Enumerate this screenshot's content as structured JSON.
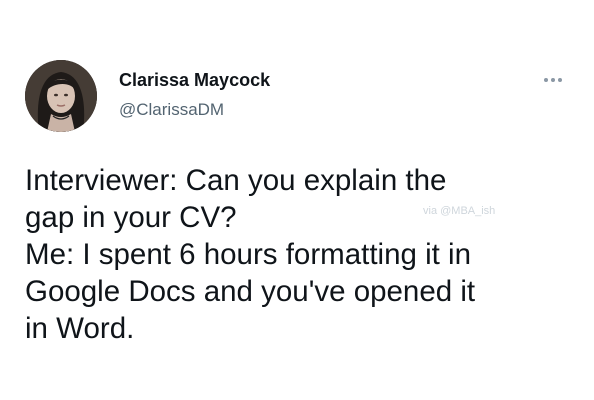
{
  "tweet": {
    "author": {
      "name": "Clarissa Maycock",
      "handle": "@ClarissaDM",
      "avatar_icon": "profile-photo"
    },
    "more_icon": "more-horizontal-icon",
    "text_lines": [
      "Interviewer: Can you explain the",
      "gap in your CV?",
      "Me: I spent 6 hours formatting it in",
      "Google Docs and you've opened it",
      "in Word."
    ],
    "watermark": "via @MBA_ish"
  }
}
